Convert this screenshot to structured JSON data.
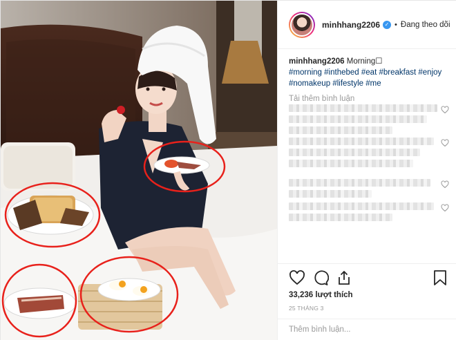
{
  "post": {
    "photo_alt": "",
    "header": {
      "username": "minhhang2206",
      "separator": "•",
      "follow_status": "Đang theo dõi"
    },
    "caption": {
      "username": "minhhang2206",
      "text": "Morning☐",
      "hashtags": [
        "#morning",
        "#inthebed",
        "#eat",
        "#breakfast",
        "#enjoy",
        "#nomakeup",
        "#lifestyle",
        "#me"
      ]
    },
    "load_more_label": "Tải thêm bình luận",
    "likes_label": "33,236 lượt thích",
    "date_label": "25 THÁNG 3",
    "comment_placeholder": "Thêm bình luận..."
  },
  "colors": {
    "accent_link": "#003569",
    "muted_text": "#999999",
    "annotation_red": "#e8211b",
    "verified_blue": "#3897f0"
  },
  "icons": [
    "verified-badge-icon",
    "heart-icon",
    "comment-icon",
    "share-icon",
    "bookmark-icon",
    "comment-heart-icon"
  ]
}
